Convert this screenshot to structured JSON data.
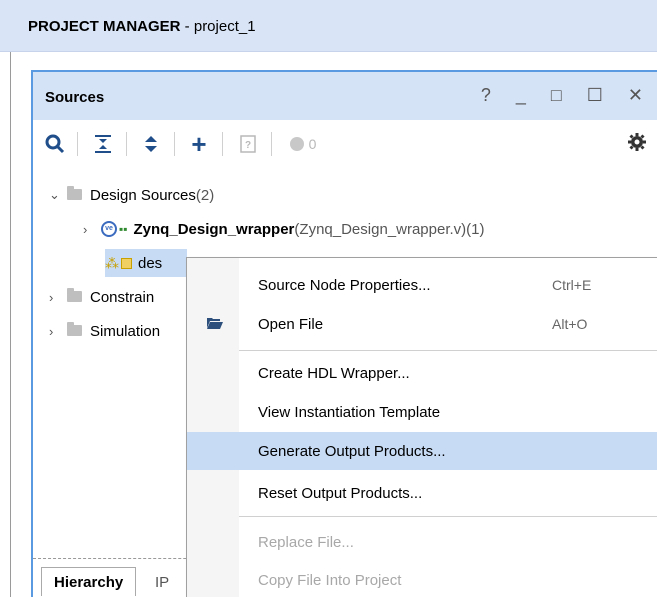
{
  "header": {
    "title_bold": "PROJECT MANAGER",
    "title_rest": " - project_1"
  },
  "panel": {
    "title": "Sources",
    "controls": "? _ □ ☐ ✕",
    "toolbar": {
      "badge_count": "0"
    }
  },
  "tree": {
    "design_sources": {
      "label": "Design Sources",
      "count": " (2)"
    },
    "wrapper": {
      "name": "Zynq_Design_wrapper",
      "file": " (Zynq_Design_wrapper.v)",
      "count": " (1)"
    },
    "design_item": {
      "label": "des"
    },
    "constraints": {
      "label": "Constrain"
    },
    "simulation": {
      "label": "Simulation"
    }
  },
  "tabs": {
    "hierarchy": "Hierarchy",
    "ip": "IP"
  },
  "context_menu": {
    "items": [
      {
        "label": "Source Node Properties...",
        "shortcut": "Ctrl+E"
      },
      {
        "label": "Open File",
        "shortcut": "Alt+O"
      },
      {
        "label": "Create HDL Wrapper..."
      },
      {
        "label": "View Instantiation Template"
      },
      {
        "label": "Generate Output Products..."
      },
      {
        "label": "Reset Output Products..."
      },
      {
        "label": "Replace File..."
      },
      {
        "label": "Copy File Into Project"
      }
    ]
  },
  "colors": {
    "selection": "#c7dbf4",
    "header_bg": "#d9e5f7",
    "accent": "#1f4e8a"
  }
}
